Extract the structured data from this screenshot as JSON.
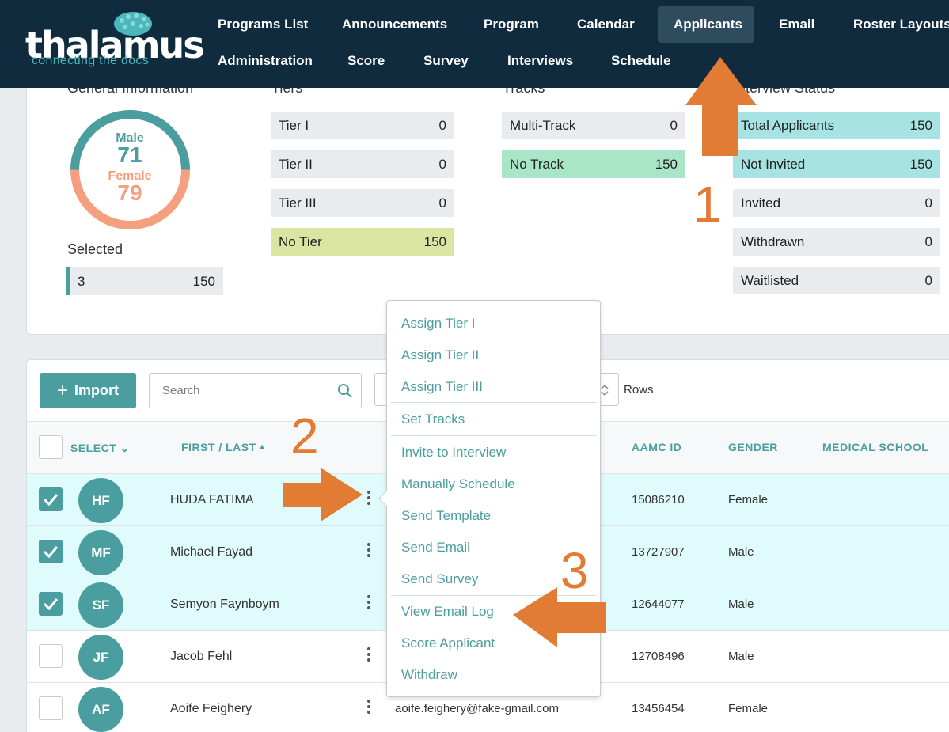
{
  "nav": {
    "logo_word": "thalamus",
    "logo_tagline": "connecting the docs",
    "items": [
      "Programs List",
      "Announcements",
      "Program",
      "Calendar",
      "Applicants",
      "Email",
      "Roster Layouts",
      "Administration",
      "Score",
      "Survey",
      "Interviews",
      "Schedule"
    ],
    "active": "Applicants"
  },
  "summary": {
    "general_title": "General Information",
    "gender": {
      "male_label": "Male",
      "male_count": "71",
      "female_label": "Female",
      "female_count": "79"
    },
    "selected_title": "Selected",
    "selected": {
      "label": "3",
      "value": "150"
    },
    "tiers_title": "Tiers",
    "tiers": [
      {
        "label": "Tier I",
        "value": "0"
      },
      {
        "label": "Tier II",
        "value": "0"
      },
      {
        "label": "Tier III",
        "value": "0"
      },
      {
        "label": "No Tier",
        "value": "150"
      }
    ],
    "tracks_title": "Tracks",
    "tracks": [
      {
        "label": "Multi-Track",
        "value": "0"
      },
      {
        "label": "No Track",
        "value": "150"
      }
    ],
    "interview_title": "Interview Status",
    "interview": [
      {
        "label": "Total Applicants",
        "value": "150"
      },
      {
        "label": "Not Invited",
        "value": "150"
      },
      {
        "label": "Invited",
        "value": "0"
      },
      {
        "label": "Withdrawn",
        "value": "0"
      },
      {
        "label": "Waitlisted",
        "value": "0"
      }
    ]
  },
  "toolbar": {
    "import_label": "Import",
    "search_placeholder": "Search",
    "rows_label": "Rows"
  },
  "table": {
    "headers": {
      "select": "SELECT",
      "name": "FIRST / LAST",
      "aamc": "AAMC ID",
      "gender": "GENDER",
      "school": "MEDICAL SCHOOL"
    },
    "rows": [
      {
        "initials": "HF",
        "name": "HUDA FATIMA",
        "email": "",
        "aamc": "15086210",
        "gender": "Female",
        "checked": true
      },
      {
        "initials": "MF",
        "name": "Michael Fayad",
        "email": "",
        "aamc": "13727907",
        "gender": "Male",
        "checked": true
      },
      {
        "initials": "SF",
        "name": "Semyon Faynboym",
        "email": "",
        "aamc": "12644077",
        "gender": "Male",
        "checked": true
      },
      {
        "initials": "JF",
        "name": "Jacob Fehl",
        "email": "",
        "aamc": "12708496",
        "gender": "Male",
        "checked": false
      },
      {
        "initials": "AF",
        "name": "Aoife Feighery",
        "email": "aoife.feighery@fake-gmail.com",
        "aamc": "13456454",
        "gender": "Female",
        "checked": false
      }
    ]
  },
  "context_menu": {
    "items": [
      "Assign Tier I",
      "Assign Tier II",
      "Assign Tier III",
      "Set Tracks",
      "Invite to Interview",
      "Manually Schedule",
      "Send Template",
      "Send Email",
      "Send Survey",
      "View Email Log",
      "Score Applicant",
      "Withdraw"
    ]
  },
  "annotations": {
    "step1": "1",
    "step2": "2",
    "step3": "3"
  },
  "colors": {
    "accent": "#4a9e9f",
    "nav_bg": "#102a3e",
    "annotation": "#e27b34",
    "male": "#4a9e9f",
    "female": "#f4a07e"
  }
}
